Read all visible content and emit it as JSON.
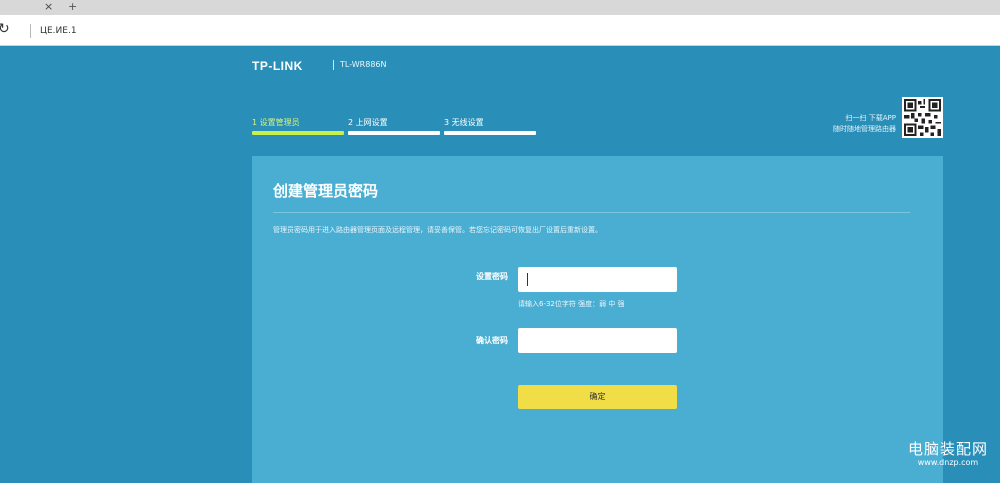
{
  "browser": {
    "tab_close": "×",
    "tab_new": "+",
    "reload_icon": "↻",
    "url": "ЦЕ.ИЕ.1"
  },
  "header": {
    "logo": "TP-LINK",
    "model": "TL-WR886N"
  },
  "steps": [
    {
      "label": "1 设置管理员",
      "active": true
    },
    {
      "label": "2 上网设置",
      "active": false
    },
    {
      "label": "3 无线设置",
      "active": false
    }
  ],
  "qr": {
    "line1": "扫一扫 下载APP",
    "line2": "随时随地管理路由器"
  },
  "card": {
    "title": "创建管理员密码",
    "description": "管理员密码用于进入路由器管理页面及远程管理，请妥善保管。若您忘记密码可恢复出厂设置后重新设置。"
  },
  "form": {
    "password_label": "设置密码",
    "password_hint": "请输入6-32位字符     强度：弱    中    强",
    "confirm_label": "确认密码",
    "submit_label": "确定"
  },
  "watermark": {
    "main": "电脑装配网",
    "sub": "www.dnzp.com"
  },
  "colors": {
    "page_bg": "#2a8fb8",
    "card_bg": "#4aaed3",
    "active_step": "#c8f04a",
    "button": "#f1de47"
  }
}
